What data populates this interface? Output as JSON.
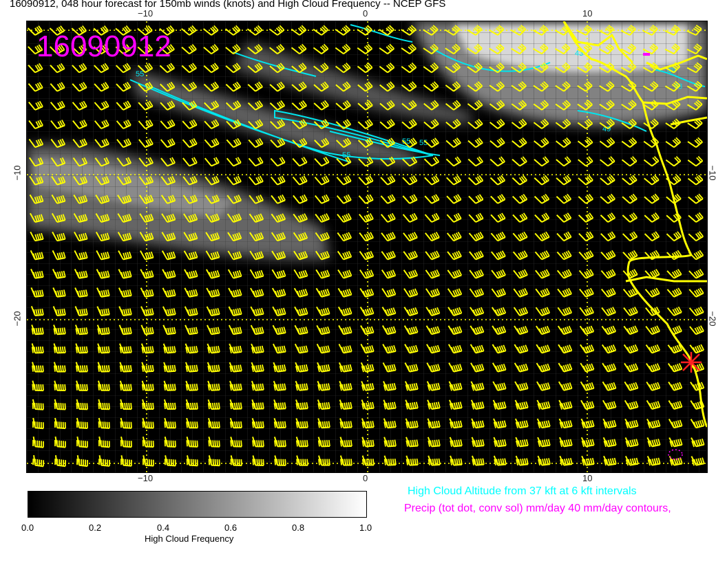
{
  "title": "16090912, 048 hour forecast for 150mb winds (knots) and High Cloud Frequency -- NCEP GFS",
  "stamp": "16090912",
  "axes": {
    "lon_top": [
      "−10",
      "0",
      "10"
    ],
    "lon_bottom": [
      "−10",
      "0",
      "10"
    ],
    "lat_left": [
      "−10",
      "−20"
    ],
    "lat_right": [
      "−10",
      "−20"
    ]
  },
  "colorbar": {
    "ticks": [
      "0.0",
      "0.2",
      "0.4",
      "0.6",
      "0.8",
      "1.0"
    ],
    "label": "High Cloud Frequency"
  },
  "notes": {
    "cloud_altitude": "High Cloud Altitude from 37 kft at 6 kft intervals",
    "precip": "Precip (tot dot, conv sol) mm/day 40 mm/day contours,"
  },
  "contour_labels": [
    "55",
    "55",
    "55",
    "55",
    "49",
    "43",
    "49",
    "43"
  ],
  "colors": {
    "barbs": "#ffff00",
    "coast": "#ffff00",
    "contours": "#00e5ee",
    "stamp": "#ff00ff",
    "marker": "#ff2020"
  }
}
